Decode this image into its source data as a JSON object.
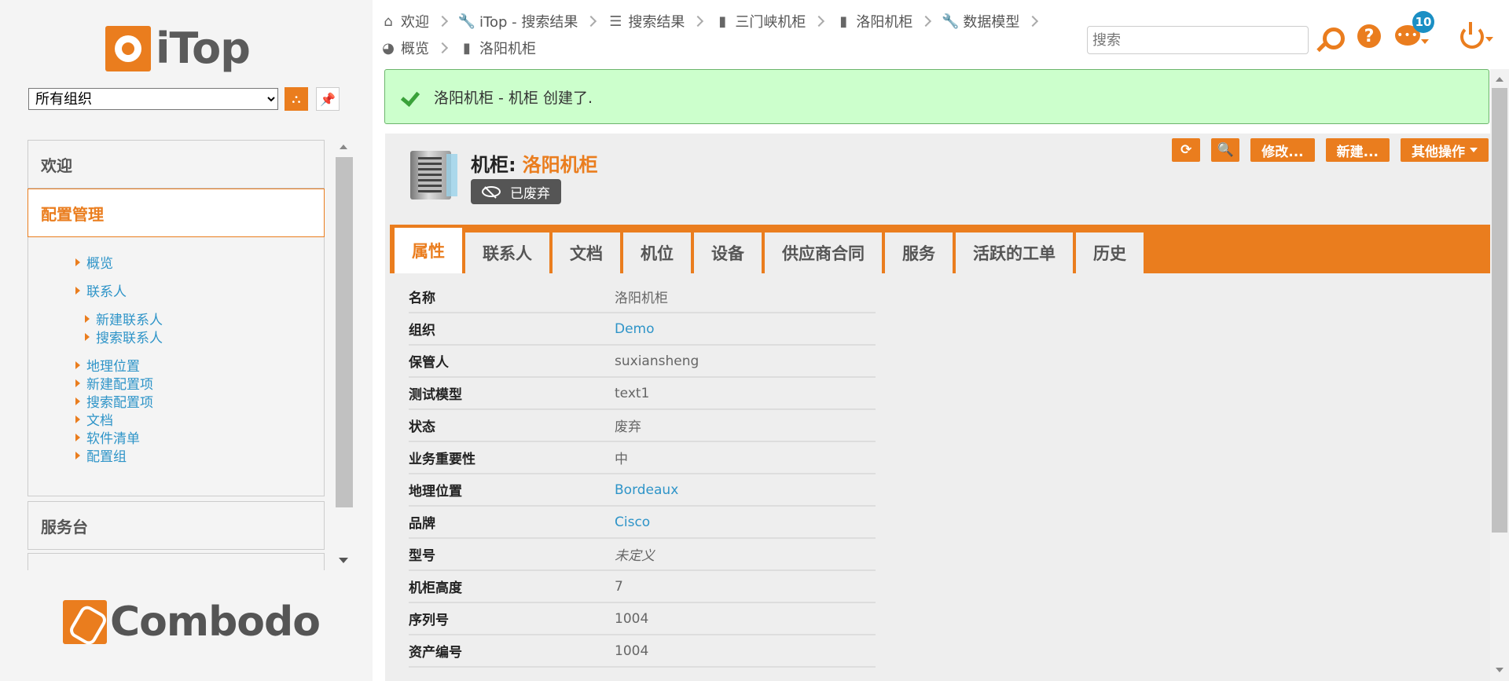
{
  "logo": {
    "text": "iTop"
  },
  "org_selector": {
    "value": "所有组织"
  },
  "menu": {
    "welcome": "欢迎",
    "config": "配置管理",
    "items": [
      {
        "label": "概览",
        "level": 1
      },
      {
        "label": "联系人",
        "level": 1
      },
      {
        "label": "新建联系人",
        "level": 2
      },
      {
        "label": "搜索联系人",
        "level": 2
      },
      {
        "label": "地理位置",
        "level": 1
      },
      {
        "label": "新建配置项",
        "level": 1
      },
      {
        "label": "搜索配置项",
        "level": 1
      },
      {
        "label": "文档",
        "level": 1
      },
      {
        "label": "软件清单",
        "level": 1
      },
      {
        "label": "配置组",
        "level": 1
      }
    ],
    "servicedesk": "服务台"
  },
  "footer_logo": {
    "text": "Combodo"
  },
  "breadcrumb": {
    "row1": [
      {
        "label": "欢迎",
        "icon": "home-icon"
      },
      {
        "label": "iTop - 搜索结果",
        "icon": "wrench-icon"
      },
      {
        "label": "搜索结果",
        "icon": "list-icon"
      },
      {
        "label": "三门峡机柜",
        "icon": "rack-icon"
      },
      {
        "label": "洛阳机柜",
        "icon": "rack-icon"
      },
      {
        "label": "数据模型",
        "icon": "wrench-icon"
      }
    ],
    "row2": [
      {
        "label": "概览",
        "icon": "pie-chart-icon"
      },
      {
        "label": "洛阳机柜",
        "icon": "rack-icon"
      }
    ]
  },
  "search": {
    "placeholder": "搜索"
  },
  "notifications": {
    "count": "10"
  },
  "alert": {
    "message": "洛阳机柜 - 机柜 创建了."
  },
  "object": {
    "class_label": "机柜:",
    "name": "洛阳机柜",
    "status": "已废弃"
  },
  "actions": {
    "edit": "修改...",
    "new": "新建...",
    "other": "其他操作"
  },
  "tabs": [
    "属性",
    "联系人",
    "文档",
    "机位",
    "设备",
    "供应商合同",
    "服务",
    "活跃的工单",
    "历史"
  ],
  "properties": [
    {
      "label": "名称",
      "value": "洛阳机柜",
      "type": "text"
    },
    {
      "label": "组织",
      "value": "Demo",
      "type": "link"
    },
    {
      "label": "保管人",
      "value": "suxiansheng",
      "type": "text"
    },
    {
      "label": "测试模型",
      "value": "text1",
      "type": "text"
    },
    {
      "label": "状态",
      "value": "废弃",
      "type": "text"
    },
    {
      "label": "业务重要性",
      "value": "中",
      "type": "text"
    },
    {
      "label": "地理位置",
      "value": "Bordeaux",
      "type": "link"
    },
    {
      "label": "品牌",
      "value": "Cisco",
      "type": "link"
    },
    {
      "label": "型号",
      "value": "未定义",
      "type": "italic"
    },
    {
      "label": "机柜高度",
      "value": "7",
      "type": "text"
    },
    {
      "label": "序列号",
      "value": "1004",
      "type": "text"
    },
    {
      "label": "资产编号",
      "value": "1004",
      "type": "text"
    }
  ]
}
